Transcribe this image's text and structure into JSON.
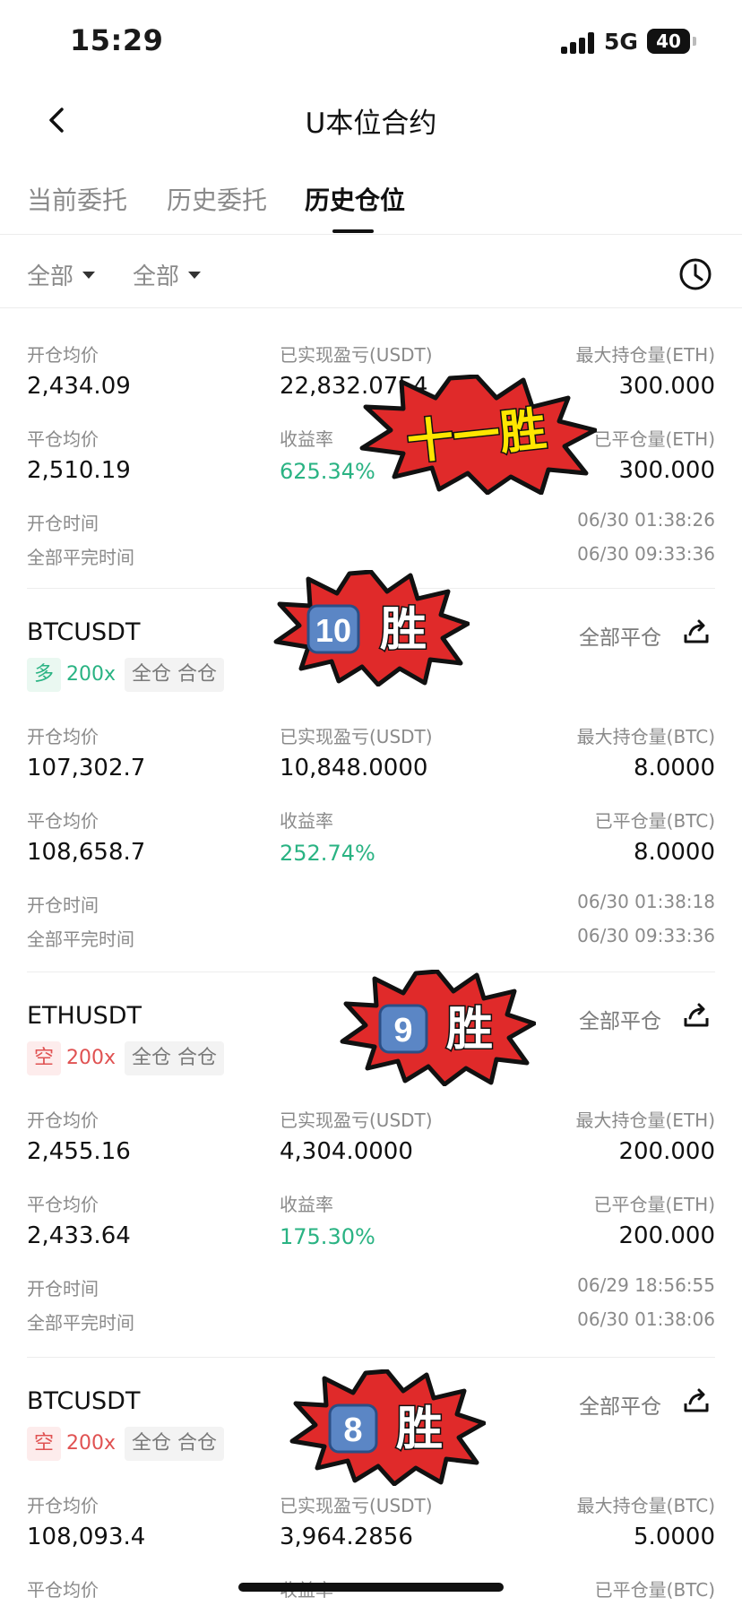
{
  "status_bar": {
    "time": "15:29",
    "network": "5G",
    "battery": "40"
  },
  "nav": {
    "title": "U本位合约"
  },
  "tabs": [
    {
      "label": "当前委托"
    },
    {
      "label": "历史委托"
    },
    {
      "label": "历史仓位",
      "active": true
    }
  ],
  "filters": [
    {
      "label": "全部"
    },
    {
      "label": "全部"
    }
  ],
  "labels": {
    "open_price": "开仓均价",
    "realized_pnl": "已实现盈亏(USDT)",
    "close_price": "平仓均价",
    "roi": "收益率",
    "open_time": "开仓时间",
    "close_time": "全部平完时间",
    "close_all": "全部平仓",
    "cross": "全仓",
    "merge": "合仓"
  },
  "cards": [
    {
      "open_price": "2,434.09",
      "realized_pnl": "22,832.0754",
      "max_qty_label": "最大持仓量(ETH)",
      "max_qty": "300.000",
      "close_price": "2,510.19",
      "roi": "625.34%",
      "closed_qty_label": "已平仓量(ETH)",
      "closed_qty": "300.000",
      "open_time": "06/30 01:38:26",
      "close_time": "06/30 09:33:36",
      "sticker": {
        "text": "十一胜"
      }
    },
    {
      "symbol": "BTCUSDT",
      "direction": "多",
      "direction_type": "long",
      "leverage": "200x",
      "open_price": "107,302.7",
      "realized_pnl": "10,848.0000",
      "max_qty_label": "最大持仓量(BTC)",
      "max_qty": "8.0000",
      "close_price": "108,658.7",
      "roi": "252.74%",
      "closed_qty_label": "已平仓量(BTC)",
      "closed_qty": "8.0000",
      "open_time": "06/30 01:38:18",
      "close_time": "06/30 09:33:36",
      "sticker": {
        "number": "10",
        "text": "胜"
      }
    },
    {
      "symbol": "ETHUSDT",
      "direction": "空",
      "direction_type": "short",
      "leverage": "200x",
      "open_price": "2,455.16",
      "realized_pnl": "4,304.0000",
      "max_qty_label": "最大持仓量(ETH)",
      "max_qty": "200.000",
      "close_price": "2,433.64",
      "roi": "175.30%",
      "closed_qty_label": "已平仓量(ETH)",
      "closed_qty": "200.000",
      "open_time": "06/29 18:56:55",
      "close_time": "06/30 01:38:06",
      "sticker": {
        "number": "9",
        "text": "胜"
      }
    },
    {
      "symbol": "BTCUSDT",
      "direction": "空",
      "direction_type": "short",
      "leverage": "200x",
      "open_price": "108,093.4",
      "realized_pnl": "3,964.2856",
      "max_qty_label": "最大持仓量(BTC)",
      "max_qty": "5.0000",
      "close_price_label_only": true,
      "roi_label_only": true,
      "closed_qty_label": "已平仓量(BTC)",
      "sticker": {
        "number": "8",
        "text": "胜"
      }
    }
  ],
  "colors": {
    "profit": "#2ab383",
    "short": "#e05252",
    "sticker_red": "#e02a2a"
  }
}
